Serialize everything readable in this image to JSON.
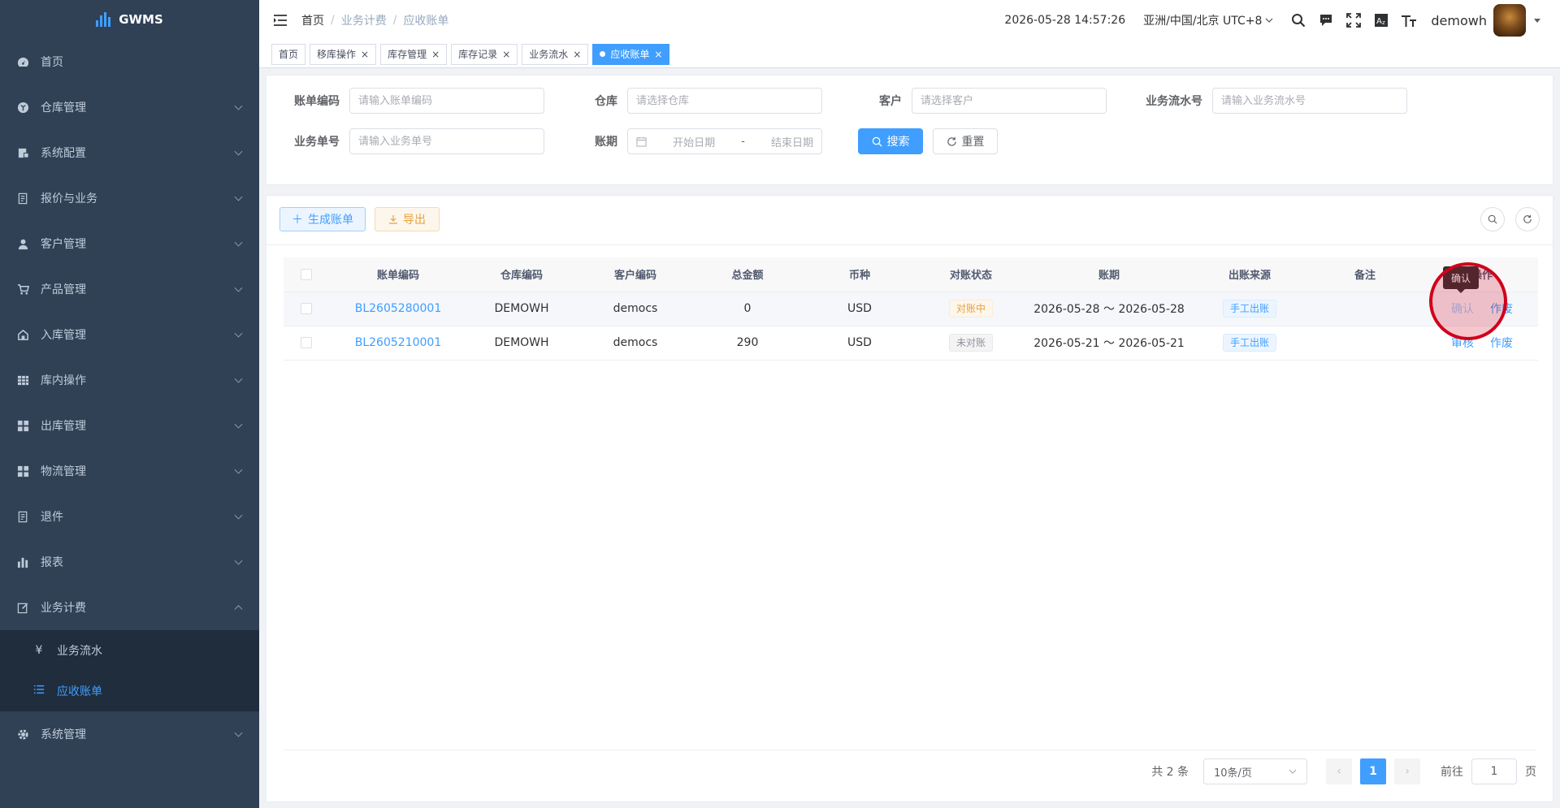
{
  "app": {
    "name": "GWMS"
  },
  "sidebar": {
    "items": [
      {
        "label": "首页",
        "icon": "dashboard-icon"
      },
      {
        "label": "仓库管理",
        "icon": "warehouse-icon"
      },
      {
        "label": "系统配置",
        "icon": "config-icon"
      },
      {
        "label": "报价与业务",
        "icon": "quote-icon"
      },
      {
        "label": "客户管理",
        "icon": "user-icon"
      },
      {
        "label": "产品管理",
        "icon": "cart-icon"
      },
      {
        "label": "入库管理",
        "icon": "inbound-icon"
      },
      {
        "label": "库内操作",
        "icon": "table-icon"
      },
      {
        "label": "出库管理",
        "icon": "grid-icon"
      },
      {
        "label": "物流管理",
        "icon": "grid-icon"
      },
      {
        "label": "退件",
        "icon": "return-icon"
      },
      {
        "label": "报表",
        "icon": "chart-icon"
      },
      {
        "label": "业务计费",
        "icon": "edit-icon"
      },
      {
        "label": "系统管理",
        "icon": "gear-icon"
      }
    ],
    "submenu": [
      {
        "label": "业务流水",
        "icon": "yen-icon"
      },
      {
        "label": "应收账单",
        "icon": "list-icon"
      }
    ]
  },
  "header": {
    "breadcrumb": [
      "首页",
      "业务计费",
      "应收账单"
    ],
    "datetime": "2026-05-28 14:57:26",
    "timezone": "亚洲/中国/北京 UTC+8",
    "username": "demowh"
  },
  "tags": [
    {
      "label": "首页"
    },
    {
      "label": "移库操作"
    },
    {
      "label": "库存管理"
    },
    {
      "label": "库存记录"
    },
    {
      "label": "业务流水"
    },
    {
      "label": "应收账单"
    }
  ],
  "search": {
    "bill_code_label": "账单编码",
    "bill_code_placeholder": "请输入账单编码",
    "warehouse_label": "仓库",
    "warehouse_placeholder": "请选择仓库",
    "customer_label": "客户",
    "customer_placeholder": "请选择客户",
    "flow_no_label": "业务流水号",
    "flow_no_placeholder": "请输入业务流水号",
    "biz_no_label": "业务单号",
    "biz_no_placeholder": "请输入业务单号",
    "period_label": "账期",
    "start_placeholder": "开始日期",
    "range_sep": "-",
    "end_placeholder": "结束日期",
    "search_btn": "搜索",
    "reset_btn": "重置"
  },
  "toolbar": {
    "generate_btn": "生成账单",
    "export_btn": "导出"
  },
  "table": {
    "columns": [
      "账单编码",
      "仓库编码",
      "客户编码",
      "总金额",
      "币种",
      "对账状态",
      "账期",
      "出账来源",
      "备注",
      "操作"
    ],
    "rows": [
      {
        "bill_code": "BL2605280001",
        "warehouse": "DEMOWH",
        "customer": "democs",
        "amount": "0",
        "currency": "USD",
        "status": "对账中",
        "period": "2026-05-28 ～ 2026-05-28",
        "source": "手工出账",
        "remark": "",
        "op1": "确认",
        "op2": "作废"
      },
      {
        "bill_code": "BL2605210001",
        "warehouse": "DEMOWH",
        "customer": "democs",
        "amount": "290",
        "currency": "USD",
        "status": "未对账",
        "period": "2026-05-21 ～ 2026-05-21",
        "source": "手工出账",
        "remark": "",
        "op1": "审核",
        "op2": "作废"
      }
    ]
  },
  "tooltip": {
    "text": "确认"
  },
  "pager": {
    "total": "共 2 条",
    "page_size": "10条/页",
    "current": "1",
    "goto_label": "前往",
    "goto_value": "1",
    "page_unit": "页"
  },
  "colors": {
    "primary": "#409eff",
    "sidebar_bg": "#304156",
    "sidebar_sub_bg": "#1f2d3d",
    "warning": "#e6a23c"
  }
}
